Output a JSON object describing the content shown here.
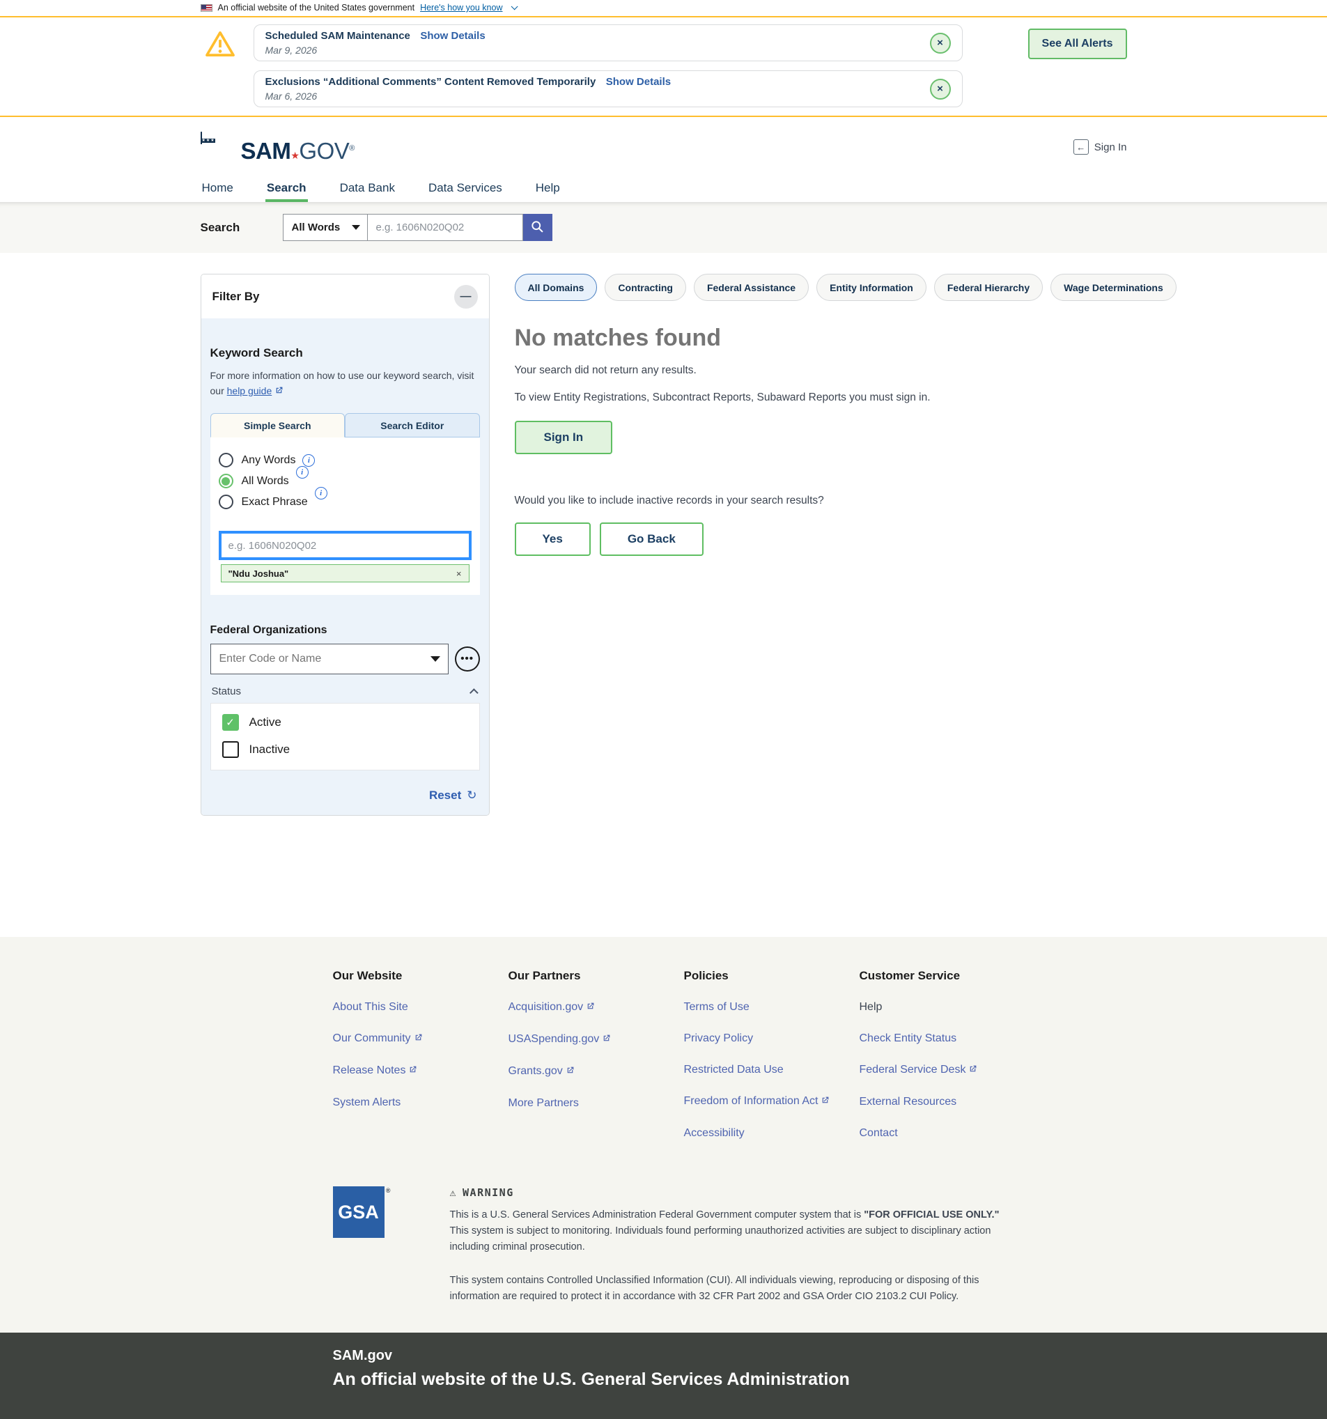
{
  "banner": {
    "text": "An official website of the United States government",
    "link": "Here's how you know"
  },
  "alerts": {
    "see_all": "See All Alerts",
    "items": [
      {
        "title": "Scheduled SAM Maintenance",
        "link": "Show Details",
        "date": "Mar 9, 2026"
      },
      {
        "title": "Exclusions “Additional Comments” Content Removed Temporarily",
        "link": "Show Details",
        "date": "Mar 6, 2026"
      }
    ]
  },
  "header": {
    "logo_sam": "SAM",
    "logo_gov": "GOV",
    "sign_in": "Sign In"
  },
  "nav": {
    "items": [
      "Home",
      "Search",
      "Data Bank",
      "Data Services",
      "Help"
    ],
    "active": "Search"
  },
  "searchbar": {
    "label": "Search",
    "mode": "All Words",
    "placeholder": "e.g. 1606N020Q02"
  },
  "filter": {
    "title": "Filter By",
    "keyword": {
      "heading": "Keyword Search",
      "info": "For more information on how to use our keyword search, visit our",
      "help_link": "help guide",
      "tabs": [
        "Simple Search",
        "Search Editor"
      ],
      "active_tab": "Simple Search",
      "radios": [
        "Any Words",
        "All Words",
        "Exact Phrase"
      ],
      "selected_radio": "All Words",
      "input_placeholder": "e.g. 1606N020Q02",
      "chip": "\"Ndu Joshua\""
    },
    "federal_orgs": {
      "heading": "Federal Organizations",
      "placeholder": "Enter Code or Name"
    },
    "status": {
      "label": "Status",
      "options": [
        {
          "label": "Active",
          "checked": true
        },
        {
          "label": "Inactive",
          "checked": false
        }
      ]
    },
    "reset": "Reset"
  },
  "domains": {
    "active": "All Domains",
    "items": [
      "All Domains",
      "Contracting",
      "Federal Assistance",
      "Entity Information",
      "Federal Hierarchy",
      "Wage Determinations"
    ]
  },
  "results": {
    "title": "No matches found",
    "line1": "Your search did not return any results.",
    "line2": "To view Entity Registrations, Subcontract Reports, Subaward Reports you must sign in.",
    "sign_in": "Sign In",
    "question": "Would you like to include inactive records in your search results?",
    "yes": "Yes",
    "go_back": "Go Back"
  },
  "footer": {
    "columns": [
      {
        "heading": "Our Website",
        "links": [
          {
            "label": "About This Site"
          },
          {
            "label": "Our Community",
            "external": true
          },
          {
            "label": "Release Notes",
            "external": true
          },
          {
            "label": "System Alerts"
          }
        ]
      },
      {
        "heading": "Our Partners",
        "links": [
          {
            "label": "Acquisition.gov",
            "external": true
          },
          {
            "label": "USASpending.gov",
            "external": true
          },
          {
            "label": "Grants.gov",
            "external": true
          },
          {
            "label": "More Partners"
          }
        ]
      },
      {
        "heading": "Policies",
        "links": [
          {
            "label": "Terms of Use"
          },
          {
            "label": "Privacy Policy"
          },
          {
            "label": "Restricted Data Use"
          },
          {
            "label": "Freedom of Information Act",
            "external": true
          },
          {
            "label": "Accessibility"
          }
        ]
      },
      {
        "heading": "Customer Service",
        "links": [
          {
            "label": "Help"
          },
          {
            "label": "Check Entity Status"
          },
          {
            "label": "Federal Service Desk",
            "external": true
          },
          {
            "label": "External Resources"
          },
          {
            "label": "Contact"
          }
        ]
      }
    ],
    "gsa": "GSA",
    "warning_title": "WARNING",
    "warning_p1_a": "This is a U.S. General Services Administration Federal Government computer system that is ",
    "warning_p1_b": "\"FOR OFFICIAL USE ONLY.\"",
    "warning_p1_c": " This system is subject to monitoring. Individuals found performing unauthorized activities are subject to disciplinary action including criminal prosecution.",
    "warning_p2": "This system contains Controlled Unclassified Information (CUI). All individuals viewing, reproducing or disposing of this information are required to protect it in accordance with 32 CFR Part 2002 and GSA Order CIO 2103.2 CUI Policy.",
    "site": "SAM.gov",
    "official": "An official website of the U.S. General Services Administration"
  }
}
